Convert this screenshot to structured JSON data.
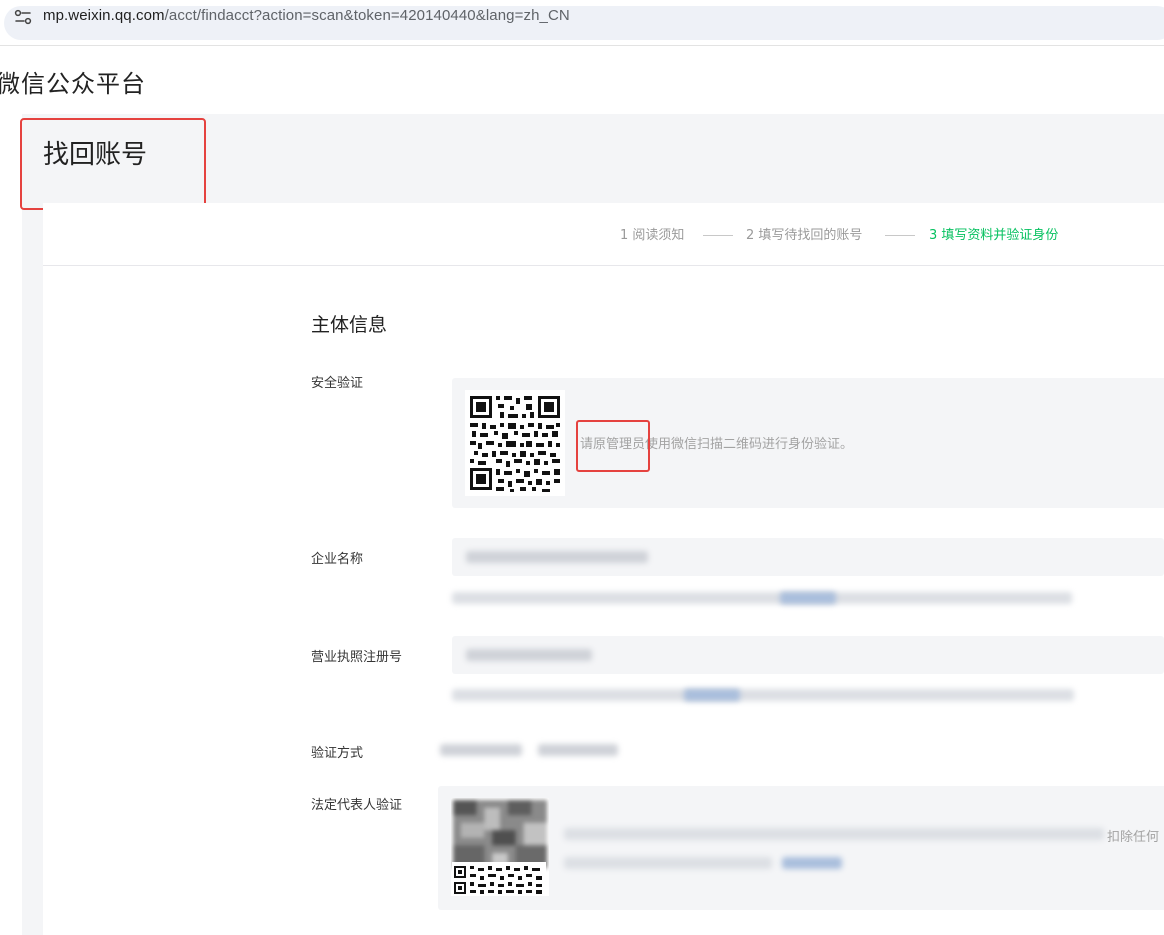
{
  "browser": {
    "url_host": "mp.weixin.qq.com",
    "url_path": "/acct/findacct?action=scan&token=420140440&lang=zh_CN"
  },
  "brand": "微信公众平台",
  "page_title": "找回账号",
  "steps": [
    {
      "label": "1 阅读须知",
      "active": false
    },
    {
      "label": "2 填写待找回的账号",
      "active": false
    },
    {
      "label": "3 填写资料并验证身份",
      "active": true
    }
  ],
  "section_title": "主体信息",
  "form": {
    "security_label": "安全验证",
    "security_tip": "请原管理员使用微信扫描二维码进行身份验证。",
    "company_label": "企业名称",
    "license_label": "营业执照注册号",
    "verify_method_label": "验证方式",
    "legal_rep_label": "法定代表人验证",
    "legal_rep_tail": "扣除任何"
  },
  "colors": {
    "accent_green": "#07c160",
    "highlight_red": "#e5423f",
    "panel_gray": "#f4f5f7"
  }
}
